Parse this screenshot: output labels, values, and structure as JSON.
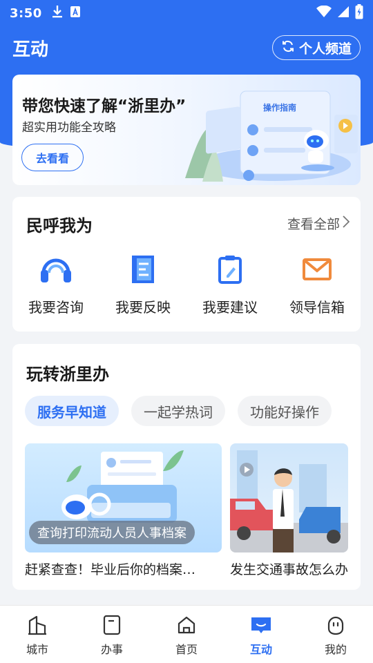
{
  "status_bar": {
    "time": "3:50",
    "icons": [
      "download-icon",
      "a-icon",
      "wifi-icon",
      "signal-icon",
      "battery-charging-icon"
    ]
  },
  "header": {
    "title": "互动",
    "channel_button_label": "个人频道",
    "channel_button_icon": "refresh-icon"
  },
  "banner": {
    "title": "带您快速了解“浙里办”",
    "subtitle": "超实用功能全攻略",
    "button_label": "去看看",
    "art_label": "操作指南"
  },
  "minhu": {
    "title": "民呼我为",
    "see_all": "查看全部",
    "items": [
      {
        "label": "我要咨询",
        "icon": "headset-icon"
      },
      {
        "label": "我要反映",
        "icon": "document-icon"
      },
      {
        "label": "我要建议",
        "icon": "clipboard-edit-icon"
      },
      {
        "label": "领导信箱",
        "icon": "mail-icon"
      }
    ]
  },
  "wanzhuan": {
    "title": "玩转浙里办",
    "tabs": [
      {
        "label": "服务早知道",
        "active": true
      },
      {
        "label": "一起学热词",
        "active": false
      },
      {
        "label": "功能好操作",
        "active": false
      }
    ],
    "articles": [
      {
        "overlay": "查询打印流动人员人事档案",
        "title": "赶紧查查！毕业后你的档案…"
      },
      {
        "overlay": "",
        "title": "发生交通事故怎么办"
      }
    ]
  },
  "bottom_nav": [
    {
      "label": "城市",
      "icon": "city-icon",
      "active": false
    },
    {
      "label": "办事",
      "icon": "document-icon",
      "active": false
    },
    {
      "label": "首页",
      "icon": "home-icon",
      "active": false
    },
    {
      "label": "互动",
      "icon": "chat-icon",
      "active": true
    },
    {
      "label": "我的",
      "icon": "profile-icon",
      "active": false
    }
  ],
  "colors": {
    "brand_blue": "#2d6ff2",
    "mail_orange": "#f08a3c",
    "page_bg": "#f2f4f7"
  }
}
